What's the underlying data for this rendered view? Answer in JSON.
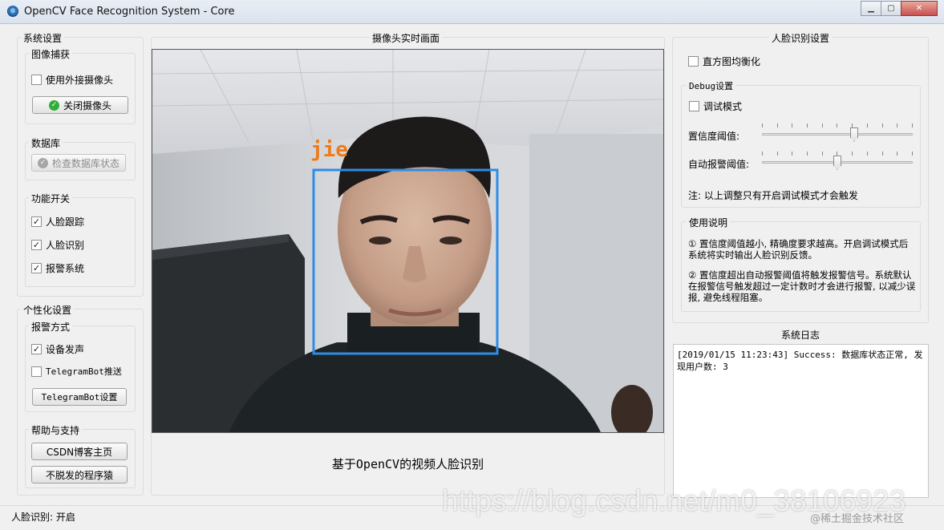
{
  "window": {
    "title": "OpenCV Face Recognition System - Core",
    "controls": {
      "minimize": "▁",
      "maximize": "▢",
      "close": "✕"
    }
  },
  "system_settings": {
    "title": "系统设置",
    "capture": {
      "title": "图像捕获",
      "external_camera_label": "使用外接摄像头",
      "external_camera_checked": false,
      "close_camera_button": "关闭摄像头"
    },
    "database": {
      "title": "数据库",
      "check_button": "检查数据库状态"
    },
    "features": {
      "title": "功能开关",
      "items": [
        {
          "label": "人脸跟踪",
          "checked": true
        },
        {
          "label": "人脸识别",
          "checked": true
        },
        {
          "label": "报警系统",
          "checked": true
        }
      ]
    }
  },
  "personalization": {
    "title": "个性化设置",
    "alarm": {
      "title": "报警方式",
      "device_sound_label": "设备发声",
      "device_sound_checked": true,
      "telegram_push_label": "TelegramBot推送",
      "telegram_push_checked": false,
      "telegram_settings_button": "TelegramBot设置"
    },
    "help": {
      "title": "帮助与支持",
      "blog_button": "CSDN博客主页",
      "author_button": "不脱发的程序猿"
    }
  },
  "camera_view": {
    "title": "摄像头实时画面",
    "face_label": "jie",
    "caption": "基于OpenCV的视频人脸识别"
  },
  "face_settings": {
    "title": "人脸识别设置",
    "histogram_label": "直方图均衡化",
    "histogram_checked": false,
    "debug": {
      "title": "Debug设置",
      "debug_mode_label": "调试模式",
      "debug_mode_checked": false,
      "confidence_label": "置信度阈值:",
      "confidence_level": 0.62,
      "alarm_label": "自动报警阈值:",
      "alarm_level": 0.5,
      "note": "注: 以上调整只有开启调试模式才会触发"
    },
    "usage": {
      "title": "使用说明",
      "p1": "① 置信度阈值越小, 精确度要求越高。开启调试模式后系统将实时输出人脸识别反馈。",
      "p2": "② 置信度超出自动报警阈值将触发报警信号。系统默认在报警信号触发超过一定计数时才会进行报警, 以减少误报, 避免线程阻塞。"
    }
  },
  "system_log": {
    "title": "系统日志",
    "entry": "[2019/01/15 11:23:43] Success: 数据库状态正常, 发现用户数: 3"
  },
  "status_bar": {
    "text": "人脸识别: 开启"
  },
  "watermark": {
    "url": "https://blog.csdn.net/m0_38106923",
    "credit": "@稀土掘金技术社区"
  }
}
